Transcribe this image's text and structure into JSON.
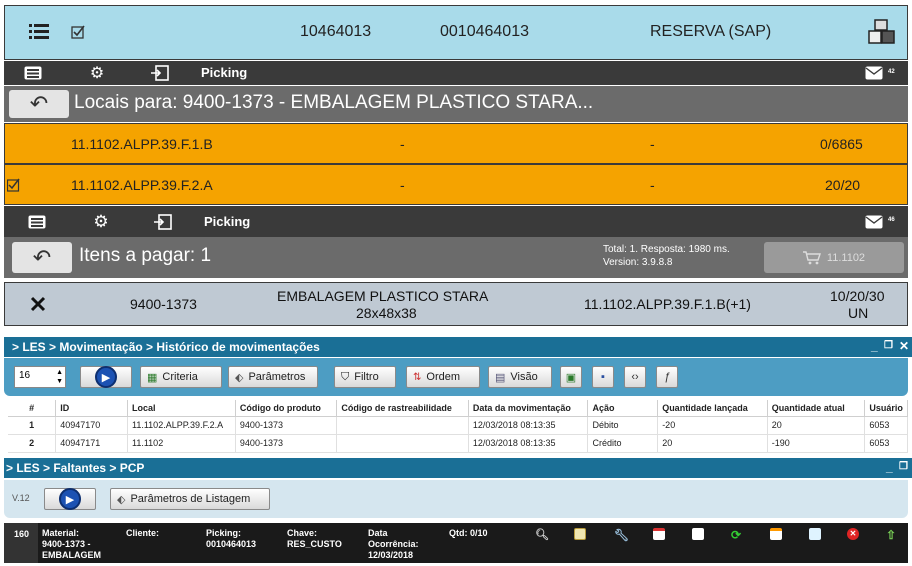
{
  "top_bar": {
    "code1": "10464013",
    "code2": "0010464013",
    "reserva": "RESERVA (SAP)"
  },
  "toolbar1": {
    "picking": "Picking",
    "badge": "42"
  },
  "locais": {
    "title": "Locais para: 9400-1373 - EMBALAGEM PLASTICO STARA...",
    "rows": [
      {
        "loc": "11.1102.ALPP.39.F.1.B",
        "c2": "-",
        "c3": "-",
        "qty": "0/6865",
        "checked": false
      },
      {
        "loc": "11.1102.ALPP.39.F.2.A",
        "c2": "-",
        "c3": "-",
        "qty": "20/20",
        "checked": true
      }
    ]
  },
  "toolbar2": {
    "picking": "Picking",
    "badge": "46"
  },
  "itens": {
    "title": "Itens a pagar: 1",
    "total": "Total: 1. Resposta: 1980 ms.",
    "version": "Version: 3.9.8.8",
    "cart_label": "11.1102"
  },
  "item_row": {
    "material": "9400-1373",
    "desc1": "EMBALAGEM PLASTICO STARA",
    "desc2": "28x48x38",
    "location": "11.1102.ALPP.39.F.1.B(+1)",
    "qty1": "10/20/30",
    "qty2": "UN"
  },
  "les1": {
    "breadcrumb": "> LES > Movimentação > Histórico de movimentações",
    "page_size": "16",
    "buttons": {
      "criteria": "Criteria",
      "parametros": "Parâmetros",
      "filtro": "Filtro",
      "ordem": "Ordem",
      "visao": "Visão"
    },
    "columns": [
      "#",
      "ID",
      "Local",
      "Código do produto",
      "Código de rastreabilidade",
      "Data da movimentação",
      "Ação",
      "Quantidade lançada",
      "Quantidade atual",
      "Usuário"
    ],
    "rows": [
      [
        "1",
        "40947170",
        "11.1102.ALPP.39.F.2.A",
        "9400-1373",
        "",
        "12/03/2018 08:13:35",
        "Débito",
        "-20",
        "20",
        "6053"
      ],
      [
        "2",
        "40947171",
        "11.1102",
        "9400-1373",
        "",
        "12/03/2018 08:13:35",
        "Crédito",
        "20",
        "-190",
        "6053"
      ]
    ]
  },
  "les2": {
    "breadcrumb": "> LES > Faltantes > PCP",
    "version": "V.12",
    "param_button": "Parâmetros de Listagem"
  },
  "bottom": {
    "num": "160",
    "material_label": "Material:",
    "material_value1": "9400-1373 -",
    "material_value2": "EMBALAGEM",
    "cliente_label": "Cliente:",
    "picking_label": "Picking:",
    "picking_value": "0010464013",
    "chave_label": "Chave:",
    "chave_value": "RES_CUSTO",
    "data_label": "Data",
    "ocorrencia_label": "Ocorrência:",
    "data_value": "12/03/2018",
    "qtd": "Qtd: 0/10"
  },
  "colors": {
    "orange": "#f5a300",
    "dark": "#3a3a3a",
    "les_blue": "#1a6f96",
    "top_blue": "#a9dbea"
  }
}
